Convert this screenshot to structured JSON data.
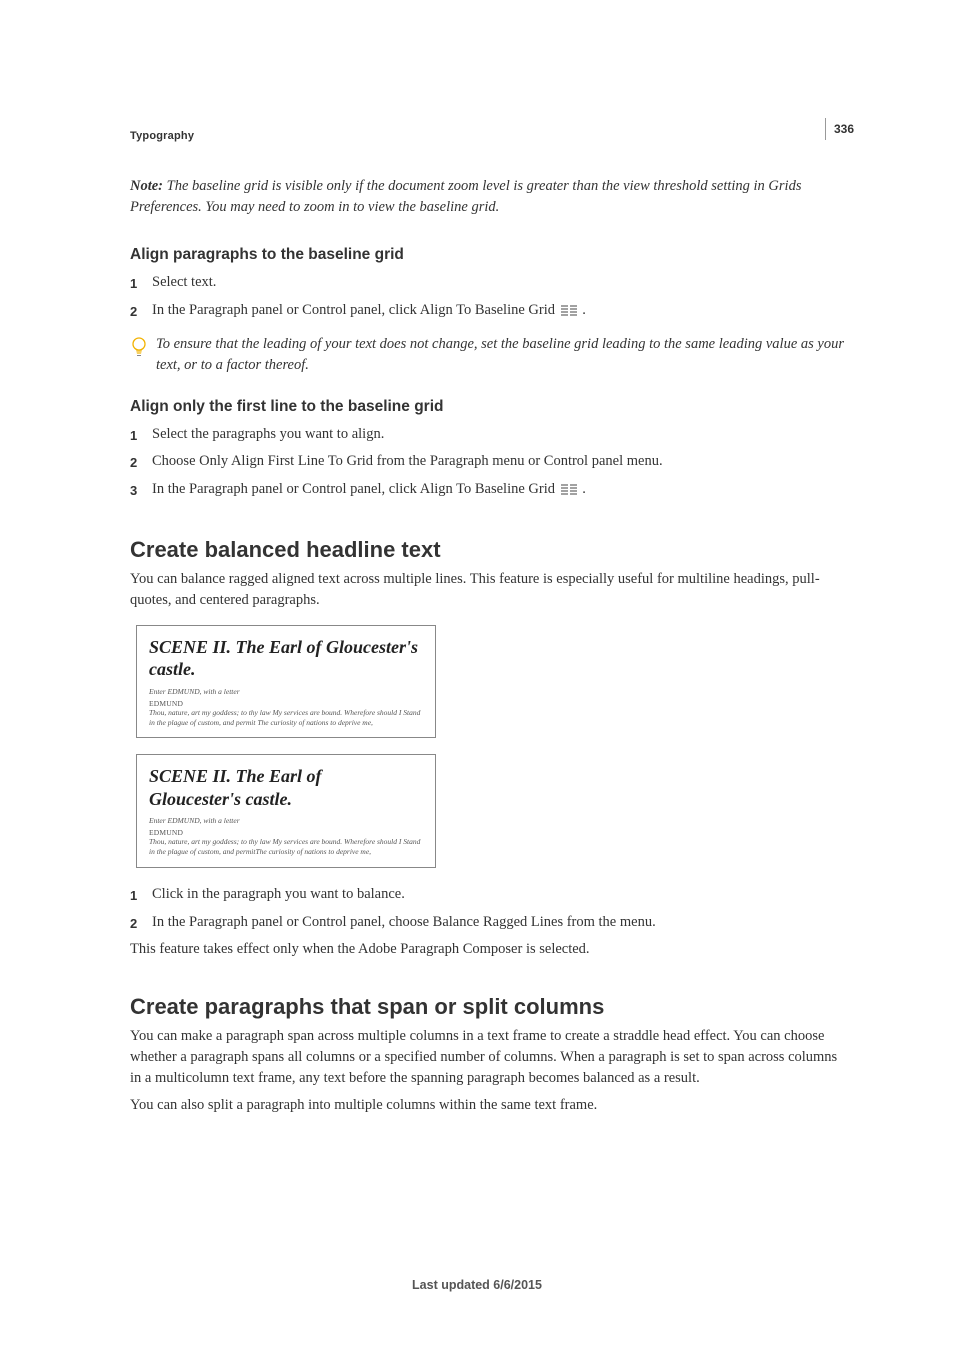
{
  "page_number": "336",
  "chapter": "Typography",
  "note": {
    "label": "Note:",
    "text": " The baseline grid is visible only if the document zoom level is greater than the view threshold setting in Grids Preferences. You may need to zoom in to view the baseline grid."
  },
  "section1": {
    "heading": "Align paragraphs to the baseline grid",
    "steps": [
      "Select text.",
      "In the Paragraph panel or Control panel, click Align To Baseline Grid "
    ],
    "step2_trail": " .",
    "tip": "To ensure that the leading of your text does not change, set the baseline grid leading to the same leading value as your text, or to a factor thereof."
  },
  "section2": {
    "heading": "Align only the first line to the baseline grid",
    "steps": [
      "Select the paragraphs you want to align.",
      "Choose Only Align First Line To Grid from the Paragraph menu or Control panel menu.",
      "In the Paragraph panel or Control panel, click Align To Baseline Grid "
    ],
    "step3_trail": " ."
  },
  "section3": {
    "heading": "Create balanced headline text",
    "intro": "You can balance ragged aligned text across multiple lines. This feature is especially useful for multiline headings, pull-quotes, and centered paragraphs.",
    "figure": {
      "card1": {
        "title": "SCENE II. The Earl of Gloucester's castle.",
        "line1": "Enter EDMUND, with a letter",
        "line2": "EDMUND",
        "body": "Thou, nature, art my goddess; to thy law My services are bound. Wherefore should I Stand in the plague of custom, and permit The curiosity of nations to deprive me,"
      },
      "card2": {
        "title": "SCENE II. The Earl of Gloucester's castle.",
        "line1": "Enter EDMUND, with a letter",
        "line2": "EDMUND",
        "body": "Thou, nature, art my goddess; to thy law My services are bound. Wherefore should I Stand in the plague of custom, and permitThe curiosity of nations to deprive me,"
      }
    },
    "steps": [
      "Click in the paragraph you want to balance.",
      "In the Paragraph panel or Control panel, choose Balance Ragged Lines from the menu."
    ],
    "outro": "This feature takes effect only when the Adobe Paragraph Composer is selected."
  },
  "section4": {
    "heading": "Create paragraphs that span or split columns",
    "p1": "You can make a paragraph span across multiple columns in a text frame to create a straddle head effect. You can choose whether a paragraph spans all columns or a specified number of columns. When a paragraph is set to span across columns in a multicolumn text frame, any text before the spanning paragraph becomes balanced as a result.",
    "p2": "You can also split a paragraph into multiple columns within the same text frame."
  },
  "footer": "Last updated 6/6/2015"
}
